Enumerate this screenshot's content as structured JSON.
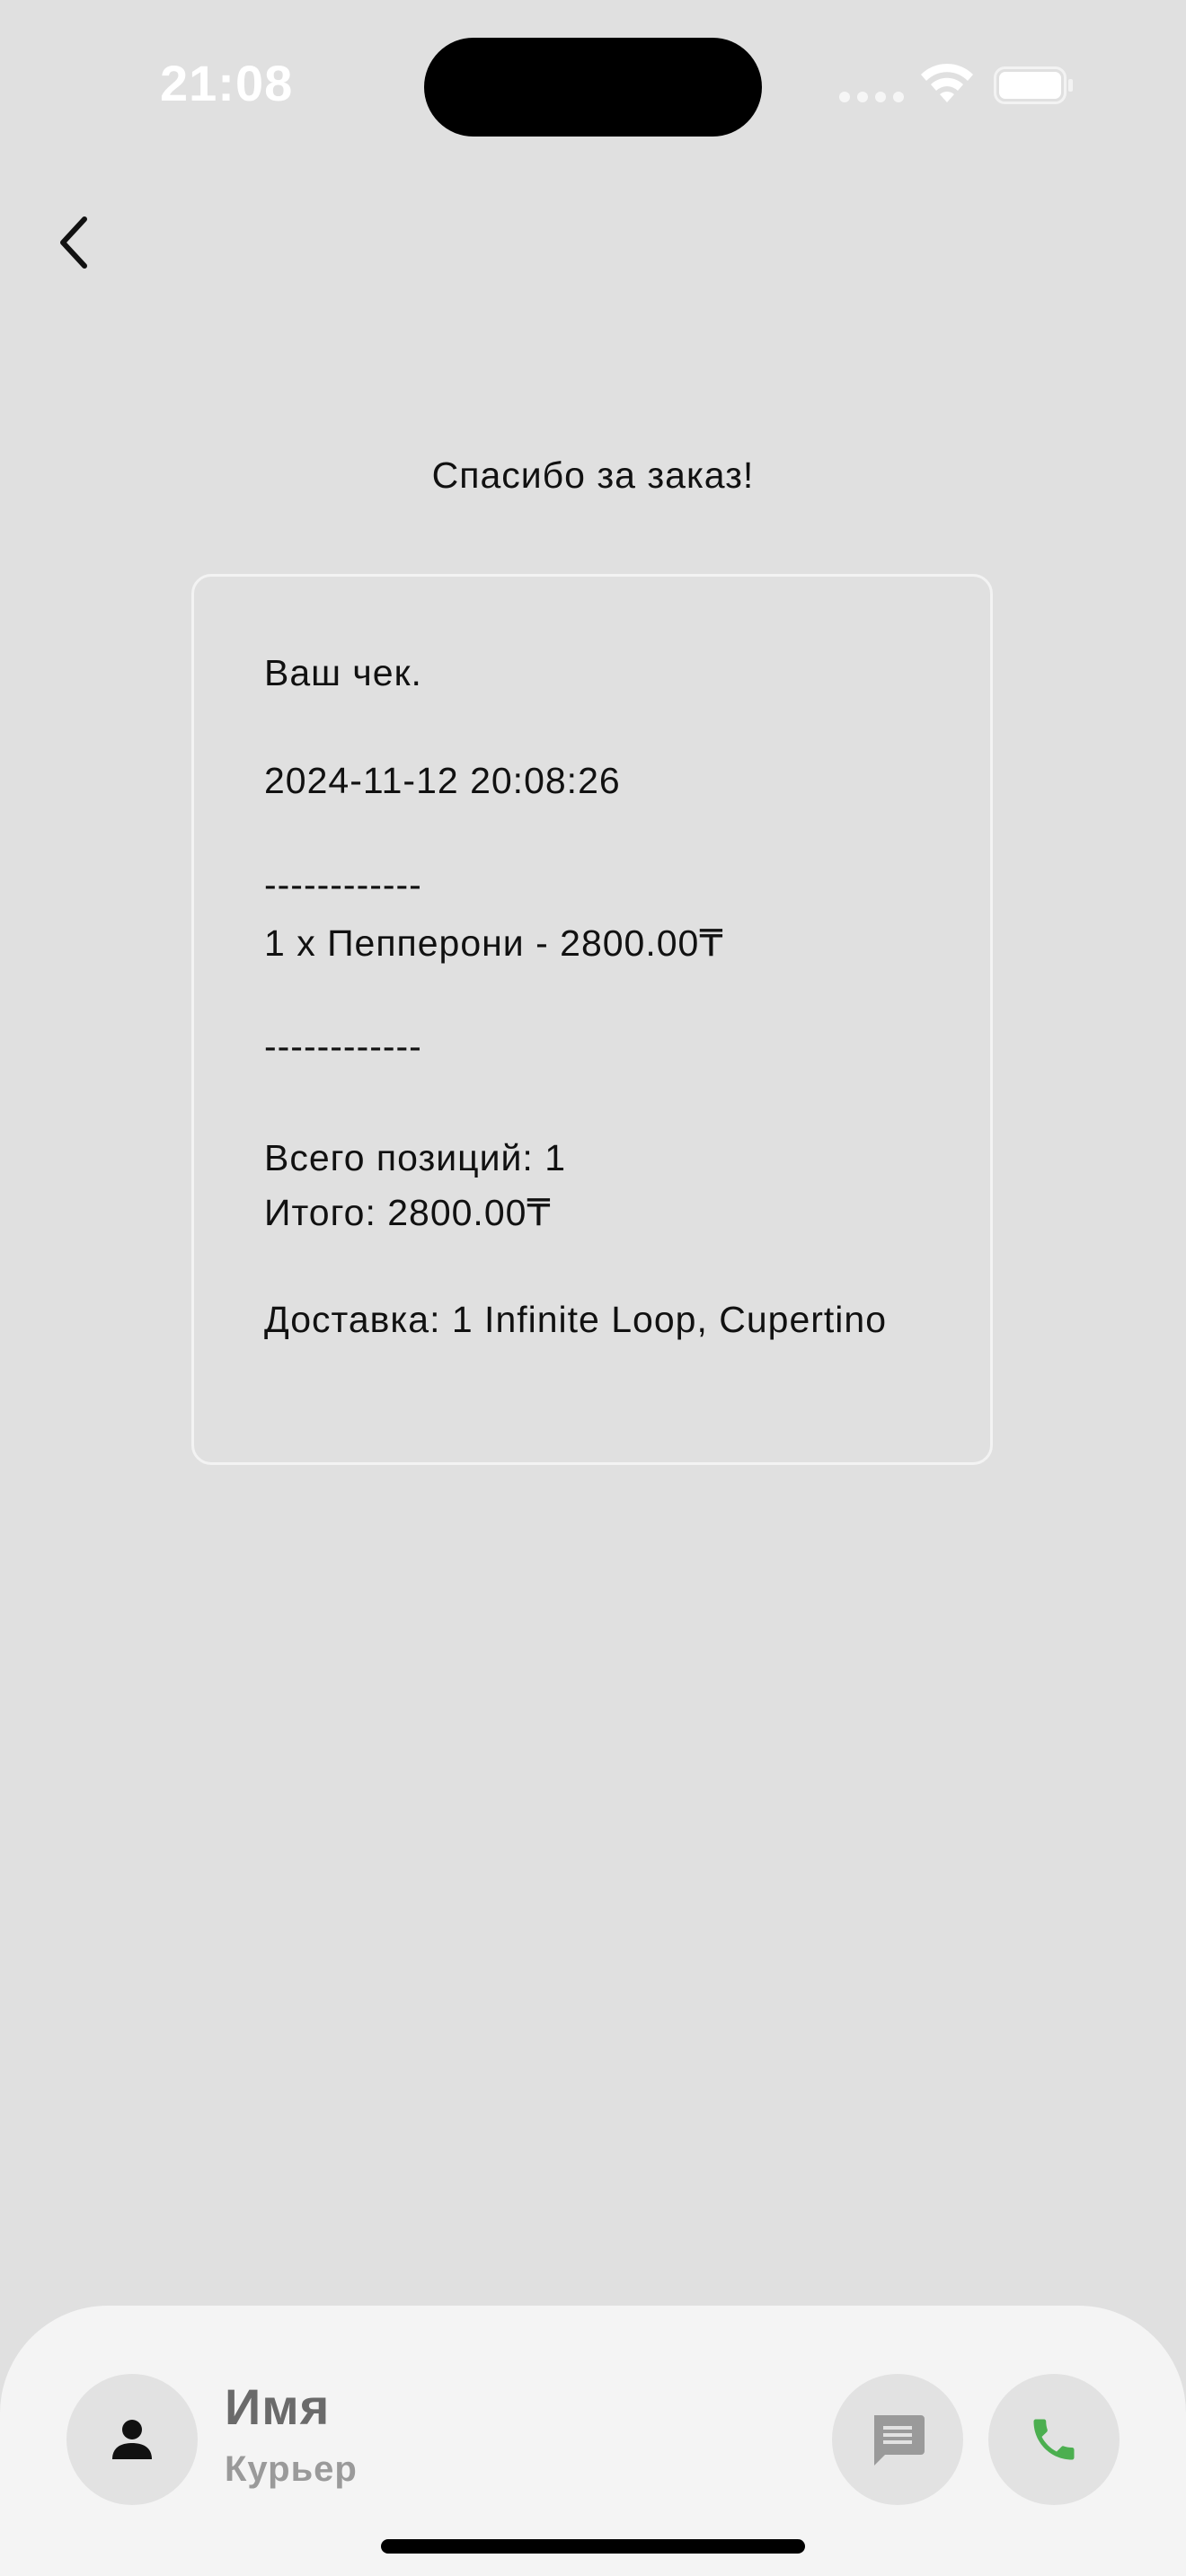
{
  "status_bar": {
    "time": "21:08",
    "icons": [
      "signal-dots-icon",
      "wifi-icon",
      "battery-icon"
    ]
  },
  "navigation": {
    "back_icon": "chevron-left-icon"
  },
  "page": {
    "title": "Спасибо за заказ!"
  },
  "receipt": {
    "heading": "Ваш чек.",
    "datetime": "2024-11-12 20:08:26",
    "separator_top": "------------",
    "items": [
      "1 x Пепперони - 2800.00₸"
    ],
    "separator_bottom": "------------",
    "total_positions": "Всего позиций: 1",
    "total": "Итого: 2800.00₸",
    "delivery": "Доставка: 1 Infinite Loop, Cupertino"
  },
  "courier": {
    "name": "Имя",
    "role": "Курьер",
    "avatar_icon": "person-icon",
    "chat_icon": "chat-icon",
    "call_icon": "phone-icon"
  },
  "colors": {
    "background": "#e0e0e0",
    "panel": "#f4f4f4",
    "button_bg": "#e2e2e2",
    "call_green": "#4caf50",
    "chat_gray": "#9a9a9a",
    "text": "#111111"
  }
}
